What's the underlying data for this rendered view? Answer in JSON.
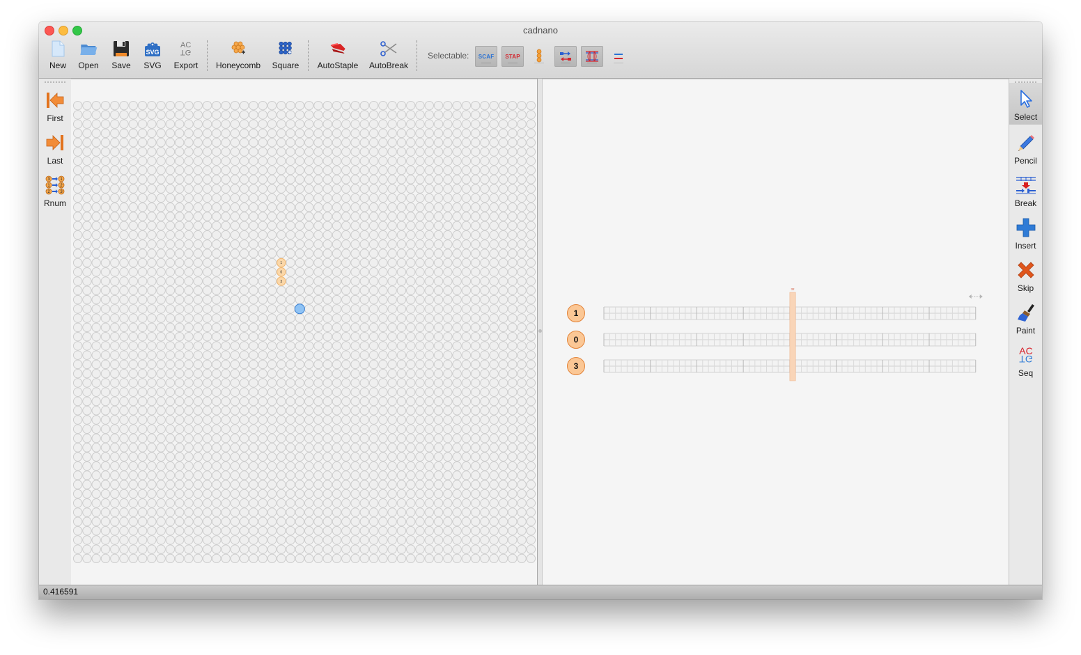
{
  "window": {
    "title": "cadnano"
  },
  "toolbar": {
    "items": [
      {
        "id": "new",
        "label": "New",
        "icon": "new-document-icon"
      },
      {
        "id": "open",
        "label": "Open",
        "icon": "open-folder-icon"
      },
      {
        "id": "save",
        "label": "Save",
        "icon": "floppy-disk-icon"
      },
      {
        "id": "svg",
        "label": "SVG",
        "icon": "svg-export-icon"
      },
      {
        "id": "export",
        "label": "Export",
        "icon": "sequence-export-icon"
      },
      {
        "id": "honeycomb",
        "label": "Honeycomb",
        "icon": "honeycomb-lattice-icon"
      },
      {
        "id": "square",
        "label": "Square",
        "icon": "square-lattice-icon"
      },
      {
        "id": "autostaple",
        "label": "AutoStaple",
        "icon": "stapler-icon"
      },
      {
        "id": "autobreak",
        "label": "AutoBreak",
        "icon": "scissors-icon"
      }
    ],
    "selectable_label": "Selectable:",
    "filters": [
      {
        "id": "scaf",
        "label": "SCAF",
        "color": "#2a72d4",
        "active": true
      },
      {
        "id": "stap",
        "label": "STAP",
        "color": "#d3262e",
        "active": true
      },
      {
        "id": "helix",
        "icon": "helix-handles-icon",
        "active": false
      },
      {
        "id": "endpoints",
        "icon": "strand-endpoints-icon",
        "active": true
      },
      {
        "id": "xovers",
        "icon": "crossovers-icon",
        "active": true
      },
      {
        "id": "strands",
        "icon": "strand-lines-icon",
        "active": false
      }
    ]
  },
  "left_toolbar": {
    "items": [
      {
        "id": "first",
        "label": "First",
        "icon": "first-arrow-icon"
      },
      {
        "id": "last",
        "label": "Last",
        "icon": "last-arrow-icon"
      },
      {
        "id": "rnum",
        "label": "Rnum",
        "icon": "renumber-icon"
      }
    ]
  },
  "right_toolbar": {
    "items": [
      {
        "id": "select",
        "label": "Select",
        "icon": "select-cursor-icon",
        "active": true
      },
      {
        "id": "pencil",
        "label": "Pencil",
        "icon": "pencil-icon",
        "active": false
      },
      {
        "id": "break",
        "label": "Break",
        "icon": "break-icon",
        "active": false
      },
      {
        "id": "insert",
        "label": "Insert",
        "icon": "insert-plus-icon",
        "active": false
      },
      {
        "id": "skip",
        "label": "Skip",
        "icon": "skip-x-icon",
        "active": false
      },
      {
        "id": "paint",
        "label": "Paint",
        "icon": "paintbrush-icon",
        "active": false
      },
      {
        "id": "seq",
        "label": "Seq",
        "icon": "sequence-icon",
        "active": false
      }
    ]
  },
  "slice_view": {
    "lattice": "square",
    "rows": 50,
    "cols": 50,
    "helices": [
      {
        "number": "1",
        "row": 17,
        "col": 22
      },
      {
        "number": "0",
        "row": 18,
        "col": 22
      },
      {
        "number": "3",
        "row": 19,
        "col": 22
      }
    ],
    "hover_slot": {
      "row": 22,
      "col": 24
    },
    "colors": {
      "slot_fill": "#efefef",
      "slot_stroke": "#cdcdcd",
      "helix_fill": "#fbd7a8",
      "helix_stroke": "#f0b56e",
      "hover_fill": "#8fc3f5",
      "hover_stroke": "#3b7fd0"
    }
  },
  "path_view": {
    "helices": [
      {
        "number": "1"
      },
      {
        "number": "0"
      },
      {
        "number": "3"
      }
    ],
    "bases": 64,
    "major_tick_every": 8,
    "slider": {
      "base": 32,
      "label": "32"
    },
    "resize_handle": "resize-arrows-icon",
    "colors": {
      "helix_fill": "#fbc795",
      "helix_stroke": "#e2843a",
      "slider": "#f9d5b8"
    }
  },
  "status_bar": {
    "text": "0.416591"
  }
}
